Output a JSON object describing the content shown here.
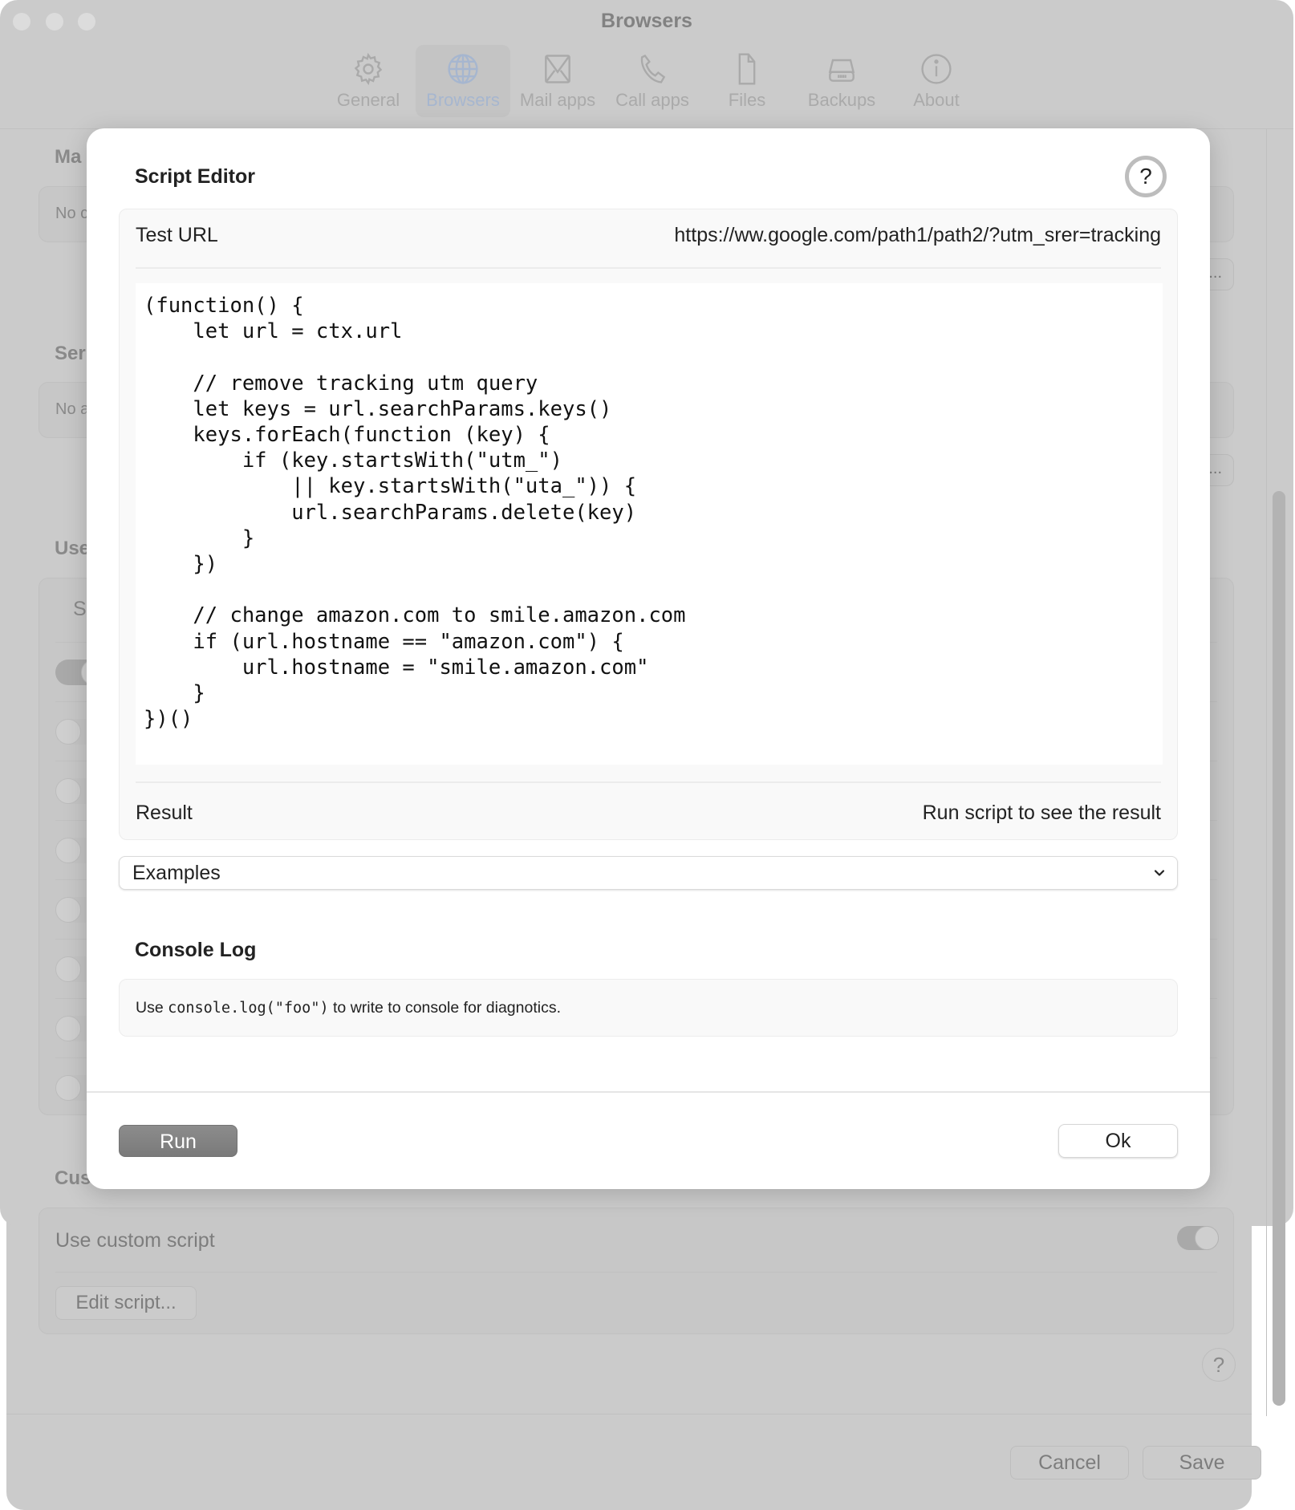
{
  "window": {
    "title": "Browsers",
    "toolbar": [
      {
        "label": "General",
        "icon": "gear-icon",
        "selected": false
      },
      {
        "label": "Browsers",
        "icon": "globe-icon",
        "selected": true
      },
      {
        "label": "Mail apps",
        "icon": "envelope-icon",
        "selected": false
      },
      {
        "label": "Call apps",
        "icon": "phone-icon",
        "selected": false
      },
      {
        "label": "Files",
        "icon": "document-icon",
        "selected": false
      },
      {
        "label": "Backups",
        "icon": "drive-icon",
        "selected": false
      },
      {
        "label": "About",
        "icon": "info-icon",
        "selected": false
      }
    ],
    "sections": {
      "match_heading_partial": "Ma",
      "match_empty_partial": "No c",
      "second_heading_partial": "Ser",
      "second_empty_partial": "No a",
      "use_heading_partial": "Use",
      "use_column_partial": "S",
      "custom_heading_partial": "Cus",
      "more_button_label": "..."
    },
    "toggles": [
      true,
      false,
      false,
      false,
      false,
      false,
      false,
      false
    ],
    "custom_script": {
      "use_label": "Use custom script",
      "use_enabled": true,
      "edit_button": "Edit script..."
    },
    "help_label": "?",
    "footer": {
      "cancel": "Cancel",
      "save": "Save"
    }
  },
  "dialog": {
    "title": "Script Editor",
    "help_label": "?",
    "test_url_label": "Test URL",
    "test_url_value": "https://ww.google.com/path1/path2/?utm_srer=tracking",
    "code": "(function() {\n    let url = ctx.url\n\n    // remove tracking utm query\n    let keys = url.searchParams.keys()\n    keys.forEach(function (key) {\n        if (key.startsWith(\"utm_\")\n            || key.startsWith(\"uta_\")) {\n            url.searchParams.delete(key)\n        }\n    })\n\n    // change amazon.com to smile.amazon.com\n    if (url.hostname == \"amazon.com\") {\n        url.hostname = \"smile.amazon.com\"\n    }\n})()",
    "result_label": "Result",
    "result_value": "Run script to see the result",
    "examples_selected": "Examples",
    "console_heading": "Console Log",
    "console_hint_prefix": "Use ",
    "console_hint_code": "console.log(\"foo\")",
    "console_hint_suffix": " to write to console for diagnotics.",
    "run_button": "Run",
    "ok_button": "Ok"
  }
}
